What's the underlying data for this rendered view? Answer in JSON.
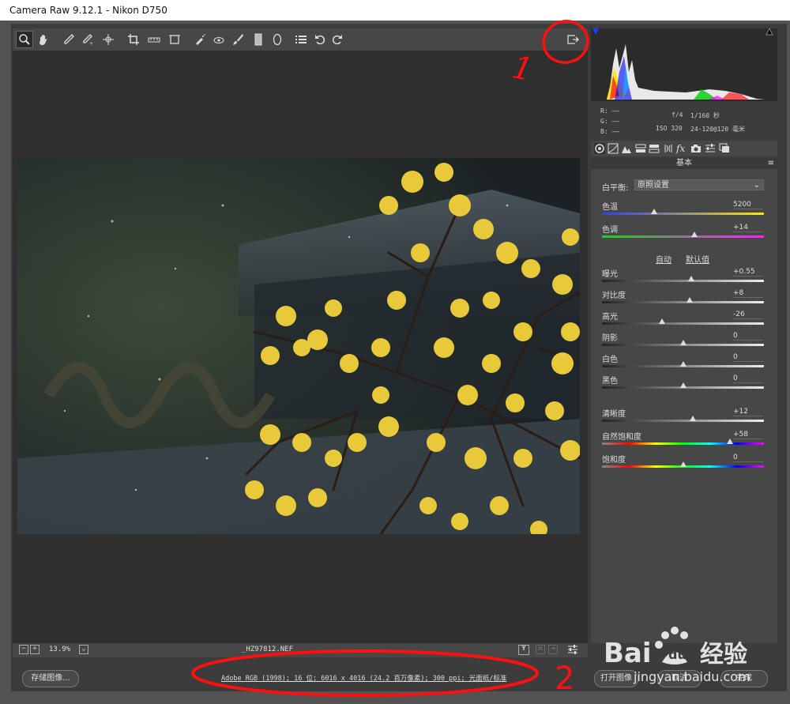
{
  "window": {
    "title": "Camera Raw 9.12.1 -  Nikon D750"
  },
  "toolbar": {
    "tools": [
      "zoom-tool",
      "hand-tool",
      "white-balance-tool",
      "color-sampler-tool",
      "targeted-adjustment-tool",
      "crop-tool",
      "straighten-tool",
      "transform-tool",
      "spot-removal-tool",
      "red-eye-tool",
      "adjustment-brush-tool",
      "graduated-filter-tool",
      "radial-filter-tool",
      "presets-list",
      "rotate-ccw",
      "rotate-cw"
    ],
    "fullscreen_icon": "fullscreen-toggle-icon"
  },
  "status": {
    "zoom": "13.9%",
    "filename": "_HZ97812.NEF"
  },
  "bottom": {
    "save_label": "存储图像...",
    "workflow_link": "Adobe RGB (1998); 16 位; 6016 x 4016 (24.2 百万像素); 300 ppi; 光面纸/标准",
    "open_label": "打开图像",
    "cancel_label": "取消",
    "done_label": "完成"
  },
  "info": {
    "r": "R:  ——",
    "g": "G:  ——",
    "b": "B:  ——",
    "aperture": "f/4",
    "shutter": "1/160 秒",
    "iso": "ISO 320",
    "lens": "24-120@120 毫米"
  },
  "panel": {
    "title": "基本",
    "wb_label": "白平衡:",
    "wb_value": "原照设置",
    "auto_label": "自动",
    "default_label": "默认值",
    "sliders": [
      {
        "label": "色温",
        "value": "5200",
        "pos": 0.32
      },
      {
        "label": "色调",
        "value": "+14",
        "pos": 0.57
      },
      {
        "label": "曝光",
        "value": "+0.55",
        "pos": 0.55
      },
      {
        "label": "对比度",
        "value": "+8",
        "pos": 0.54
      },
      {
        "label": "高光",
        "value": "-26",
        "pos": 0.37
      },
      {
        "label": "阴影",
        "value": "0",
        "pos": 0.5
      },
      {
        "label": "白色",
        "value": "0",
        "pos": 0.5
      },
      {
        "label": "黑色",
        "value": "0",
        "pos": 0.5
      },
      {
        "label": "清晰度",
        "value": "+12",
        "pos": 0.56
      },
      {
        "label": "自然饱和度",
        "value": "+58",
        "pos": 0.79
      },
      {
        "label": "饱和度",
        "value": "0",
        "pos": 0.5
      }
    ]
  },
  "annotations": {
    "one": "1",
    "two": "2"
  },
  "watermark": {
    "brand": "Bai",
    "suffix": "经验",
    "site": "jingyan.baidu.com"
  }
}
